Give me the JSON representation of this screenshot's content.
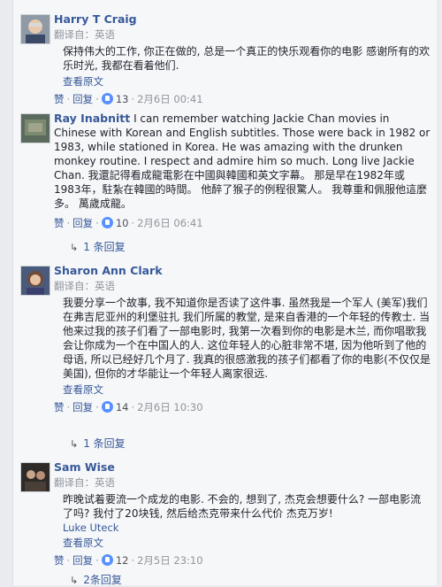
{
  "comments": [
    {
      "author": "Harry T Craig",
      "translated_from": "翻译自：英语",
      "text": "保持伟大的工作, 你正在做的, 总是一个真正的快乐观看你的电影 感谢所有的欢乐时光, 我都在看着他们.",
      "see_original": "查看原文",
      "like": "赞",
      "reply": "回复",
      "likes": "13",
      "time": "2月6日 00:41"
    },
    {
      "author": "Ray Inabnitt",
      "text": "I can remember watching Jackie Chan movies in Chinese with Korean and English subtitles. Those were back in 1982 or 1983, while stationed in Korea. He was amazing with the drunken monkey routine. I respect and admire him so much. Long live Jackie Chan. 我還記得看成龍電影在中國與韓國和英文字幕。 那是早在1982年或1983年，駐紮在韓國的時間。 他醉了猴子的例程很驚人。 我尊重和佩服他這麼多。 萬歲成龍。",
      "like": "赞",
      "reply": "回复",
      "likes": "10",
      "time": "2月6日 06:41",
      "replies": "1 条回复"
    },
    {
      "author": "Sharon Ann Clark",
      "translated_from": "翻译自：英语",
      "text": "我要分享一个故事, 我不知道你是否读了这件事. 虽然我是一个军人 (美军)我们在弗吉尼亚州的利堡驻扎 我们所属的教堂, 是来自香港的一个年轻的传教士. 当他来过我的孩子们看了一部电影时, 我第一次看到你的电影是木兰, 而你唱歌我会让你成为一个在中国人的人. 这位年轻人的心脏非常不堪, 因为他听到了他的母语, 所以已经好几个月了. 我真的很感激我的孩子们都看了你的电影(不仅仅是美国), 但你的才华能让一个年轻人离家很远.",
      "see_original": "查看原文",
      "like": "赞",
      "reply": "回复",
      "likes": "14",
      "time": "2月6日 10:30",
      "replies": "1 条回复"
    },
    {
      "author": "Sam Wise",
      "translated_from": "翻译自：英语",
      "text": "昨晚试着要流一个成龙的电影. 不会的, 想到了, 杰克会想要什么? 一部电影流了吗? 我付了20块钱, 然后给杰克带来什么代价 杰克万岁!",
      "mention": "Luke Uteck",
      "see_original": "查看原文",
      "like": "赞",
      "reply": "回复",
      "likes": "12",
      "time": "2月5日 23:10",
      "replies": "2条回复"
    }
  ],
  "colors": {
    "link": "#365899",
    "meta": "#90949c",
    "like_badge": "#5890ff",
    "panel": "#f6f7f9"
  }
}
